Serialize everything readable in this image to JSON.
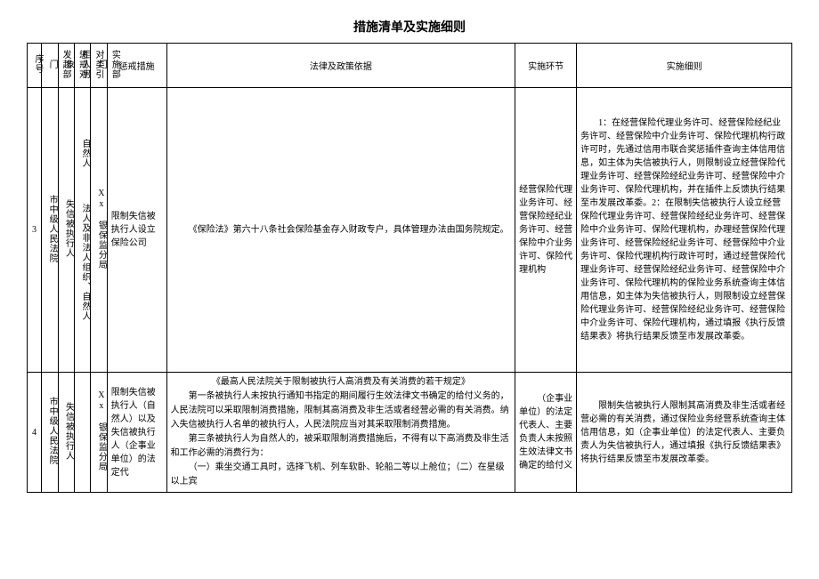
{
  "title": "措施清单及实施细则",
  "headers": {
    "seq": "序号",
    "dept1": "发起部门",
    "target": "惩戒对象",
    "other": "对类引相人另",
    "dept2": "实施部门",
    "measure": "惩戒措施",
    "basis": "法律及政策依据",
    "step": "实施环节",
    "detail": "实施细则"
  },
  "rows": [
    {
      "seq": "3",
      "dept1": "市中级人民法院",
      "target": "失信被执行人",
      "other": "法人及非法人组织、自然人",
      "dept2": "Xx 银保监分局",
      "other_top": "自然人",
      "measure": "限制失信被执行人设立保险公司",
      "basis": "《保险法》第六十八条社会保险基金存入财政专户，具体管理办法由国务院规定。",
      "step": "经营保险代理业务许可、经营保险经纪业务许可、经营保险中介业务许可、保险代理机构",
      "detail": "1：在经营保险代理业务许可、经营保险经纪业务许可、经营保险中介业务许可、保险代理机构行政许可时，先通过信用市联合奖惩插件查询主体信用信息，如主体为失信被执行人，则限制设立经营保险代理业务许可、经营保险经纪业务许可、经营保险中介业务许可、保险代理机构，并在插件上反馈执行结果至市发展改革委。2：在限制失信被执行人设立经营保险代理业务许可、经营保险经纪业务许可、经营保险中介业务许可、保险代理机构，办理经营保险代理业务许可、经营保险经纪业务许可、经营保险中介业务许可、保险代理机构行政许可时，通过经营保险代理业务许可、经营保险经纪业务许可、经营保险中介业务许可、保险代理机构的保险业务系统查询主体信用信息，如主体为失信被执行人，则限制设立经营保险代理业务许可、经营保险经纪业务许可、经营保险中介业务许可、保险代理机构，通过填报《执行反馈结果表》将执行结果反馈至市发展改革委。"
    },
    {
      "seq": "4",
      "dept1": "市中级人民法院",
      "target": "失信被执行人",
      "other": "",
      "dept2": "Xx 银保监分局",
      "measure": "限制失信被执行人（自然人）以及失信被执行人（企事业单位）的法定代",
      "basis_lines": [
        "《最高人民法院关于限制被执行人高消费及有关消费的若干规定》",
        "第一条被执行人未按执行通知书指定的期间履行生效法律文书确定的给付义务的，人民法院可以采取限制消费措施，限制其高消费及非生活或者经营必需的有关消费。纳入失信被执行人名单的被执行人，人民法院应当对其采取限制消费措施。",
        "第三条被执行人为自然人的，被采取限制消费措施后，不得有以下高消费及非生活和工作必需的消费行为：",
        "（一）乘坐交通工具时，选择飞机、列车软卧、轮船二等以上舱位；（二）在星级以上宾"
      ],
      "step": "（企事业单位）的法定代表人、主要负责人未按照生效法律文书确定的给付义",
      "detail": "限制失信被执行人限制其高消费及非生活或者经营必需的有关消费，通过保险业务经营系统查询主体信用信息，如（企事业单位）的法定代表人、主要负责人为失信被执行人，通过填报《执行反馈结果表》将执行结果反馈至市发展改革委。"
    }
  ]
}
